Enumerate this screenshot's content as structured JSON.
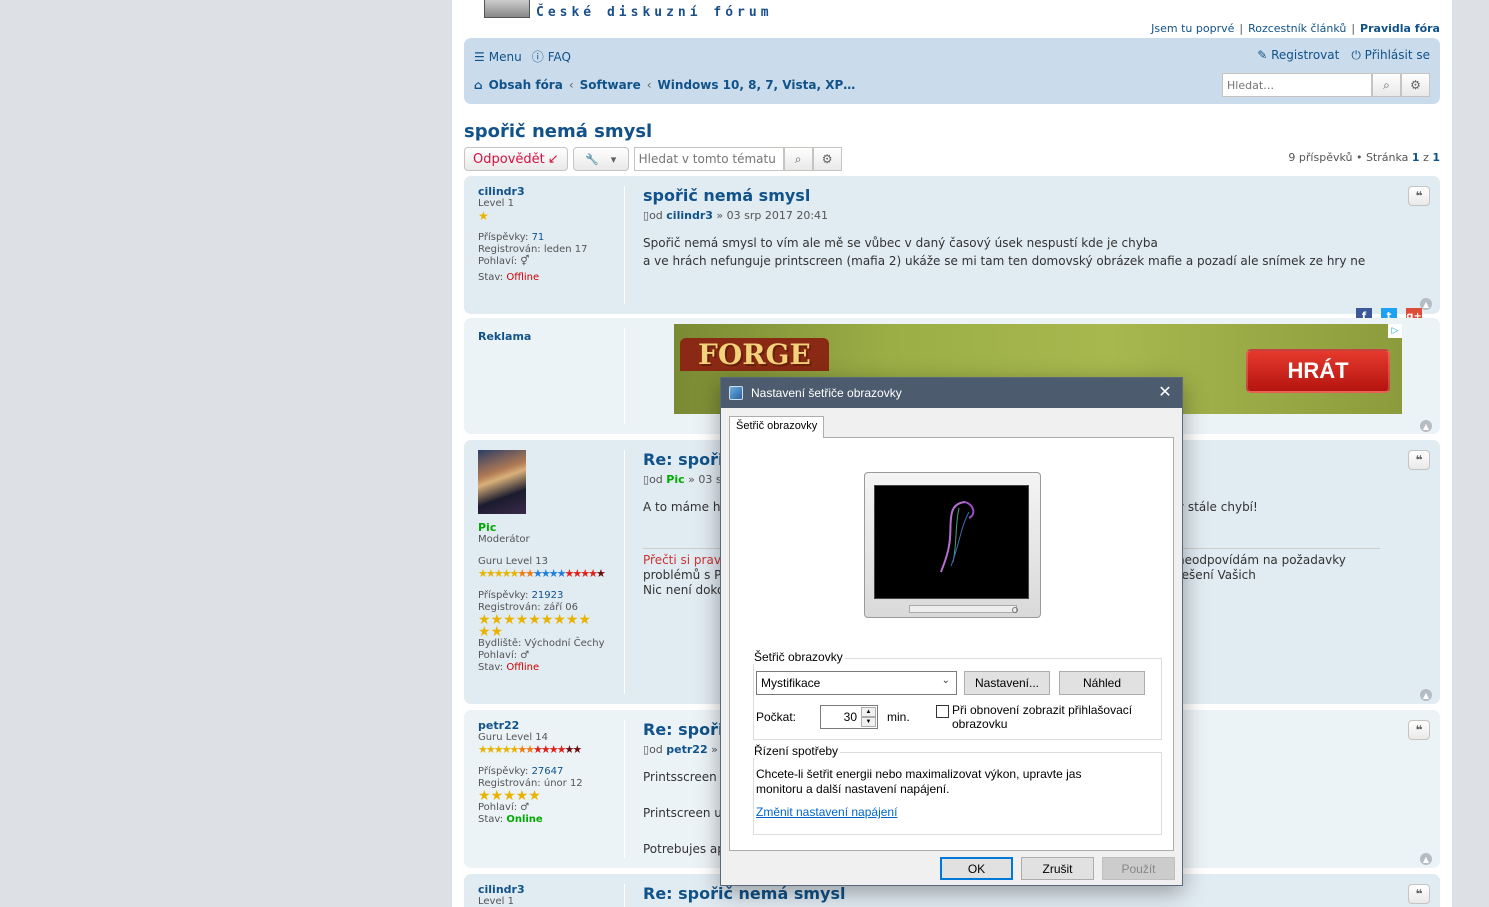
{
  "header": {
    "logo_text": "České diskuzní fórum",
    "links": [
      "Jsem tu poprvé",
      "Rozcestník článků",
      "Pravidla fóra"
    ]
  },
  "navbar": {
    "menu": "Menu",
    "faq": "FAQ",
    "register": "Registrovat",
    "login": "Přihlásit se",
    "breadcrumbs": [
      "Obsah fóra",
      "Software",
      "Windows 10, 8, 7, Vista, XP…"
    ],
    "search_placeholder": "Hledat…"
  },
  "topic": {
    "title": "spořič nemá smysl",
    "reply_label": "Odpovědět",
    "search_placeholder": "Hledat v tomto tématu",
    "pagination": {
      "count_text": "9 příspěvků • Stránka",
      "current": "1",
      "of": "z",
      "total": "1"
    }
  },
  "labels": {
    "posts": "Příspěvky:",
    "registered": "Registrován:",
    "gender": "Pohlaví:",
    "status": "Stav:",
    "location": "Bydliště:",
    "from": "od",
    "sep": "»"
  },
  "posts": [
    {
      "username": "cilindr3",
      "rank": "Level 1",
      "posts": "71",
      "registered": "leden 17",
      "status": "Offline",
      "title": "spořič nemá smysl",
      "author": "cilindr3",
      "date": "03 srp 2017 20:41",
      "content": [
        "Spořič nemá smysl to vím ale mě se vůbec v daný časový úsek nespustí kde je chyba",
        "a ve hrách nefunguje printscreen (mafia 2) ukáže se mi tam ten domovský obrázek mafie a pozadí ale snímek ze hry ne"
      ]
    },
    {
      "username": "Pic",
      "rank": "Moderátor",
      "rank2": "Guru Level 13",
      "posts": "21923",
      "registered": "září 06",
      "location": "Východní Čechy",
      "status": "Offline",
      "title": "Re: spořič n",
      "author": "Pic",
      "date": "03 s",
      "content_left": "A to máme ha",
      "content_right": "y stále chybí!",
      "sig_left": [
        "Přečti si pravid",
        "problémů s PC",
        "Nic není dokon"
      ],
      "sig_right": "neodpovídám na požadavky řešení Vašich"
    },
    {
      "username": "petr22",
      "rank": "Guru Level 14",
      "posts": "27647",
      "registered": "únor 12",
      "status": "Online",
      "title": "Re: spořič",
      "author": "petr22",
      "content": [
        "Printsscreen f",
        "Printscreen u",
        "Potrebujes ap"
      ]
    },
    {
      "username": "cilindr3",
      "rank": "Level 1",
      "title": "Re: spořič nemá smysl"
    }
  ],
  "ad": {
    "label": "Reklama",
    "brand": "FORGE",
    "cta": "HRÁT"
  },
  "dialog": {
    "title": "Nastavení šetřiče obrazovky",
    "tab": "Šetřič obrazovky",
    "group1": "Šetřič obrazovky",
    "selected_saver": "Mystifikace",
    "settings_btn": "Nastavení...",
    "preview_btn": "Náhled",
    "wait_label": "Počkat:",
    "wait_value": "30",
    "wait_unit": "min.",
    "checkbox_label": "Při obnovení zobrazit přihlašovací obrazovku",
    "checkbox_checked": false,
    "group2": "Řízení spotřeby",
    "power_text": "Chcete-li šetřit energii nebo maximalizovat výkon, upravte jas monitoru a další nastavení napájení.",
    "power_link": "Změnit nastavení napájení",
    "ok": "OK",
    "cancel": "Zrušit",
    "apply": "Použít"
  }
}
